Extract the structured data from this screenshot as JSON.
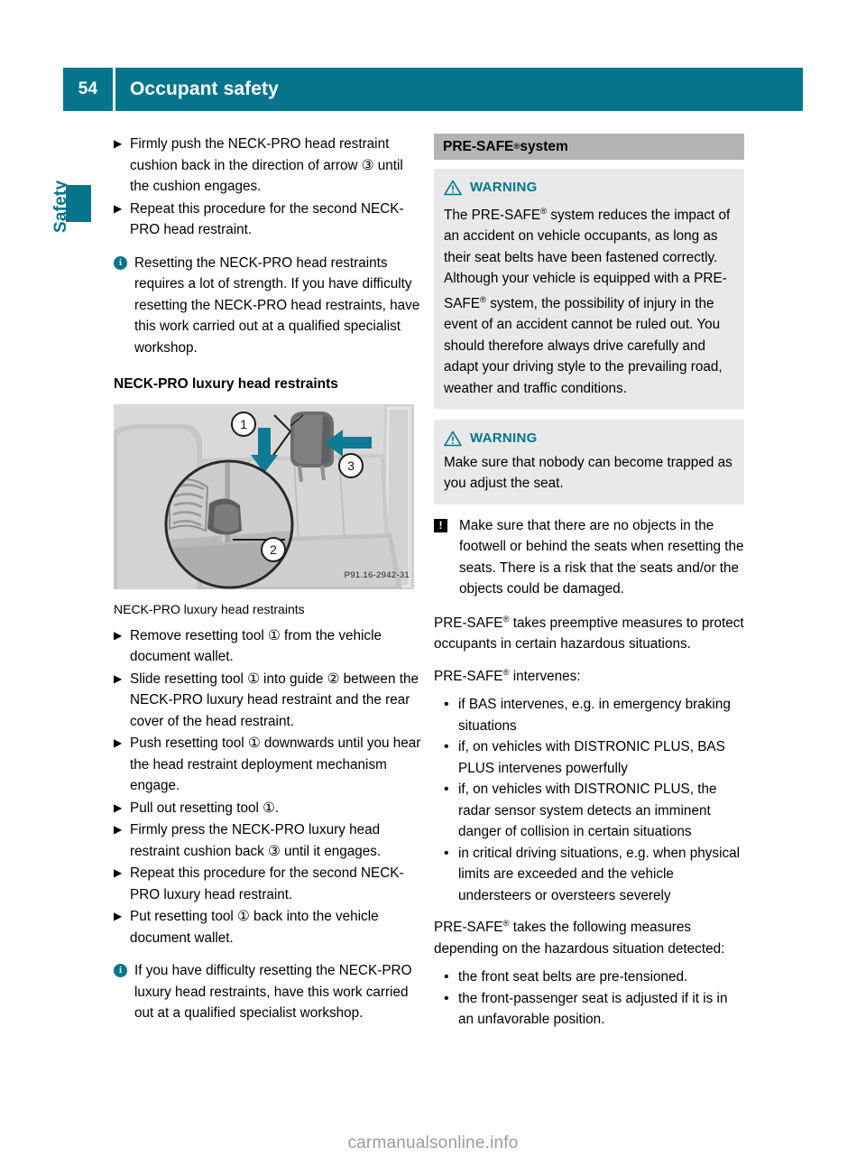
{
  "header": {
    "page_number": "54",
    "title": "Occupant safety",
    "bar_color": "#05758c"
  },
  "chapter_tab": {
    "label": "Safety",
    "color": "#05758c"
  },
  "left_column": {
    "steps_top": [
      "Firmly push the NECK-PRO head restraint cushion back in the direction of arrow ③ until the cushion engages.",
      "Repeat this procedure for the second NECK-PRO head restraint."
    ],
    "note_top": {
      "icon": "info-icon",
      "text": "Resetting the NECK-PRO head restraints requires a lot of strength. If you have difficulty resetting the NECK-PRO head restraints, have this work carried out at a qualified specialist workshop."
    },
    "subheading": "NECK-PRO luxury head restraints",
    "figure": {
      "caption": "NECK-PRO luxury head restraints",
      "code": "P91.16-2942-31",
      "callouts": [
        "1",
        "2",
        "3"
      ]
    },
    "steps_bottom": [
      "Remove resetting tool ① from the vehicle document wallet.",
      "Slide resetting tool ① into guide ② between the NECK-PRO luxury head restraint and the rear cover of the head restraint.",
      "Push resetting tool ① downwards until you hear the head restraint deployment mechanism engage.",
      "Pull out resetting tool ①.",
      "Firmly press the NECK-PRO luxury head restraint cushion back ③ until it engages.",
      "Repeat this procedure for the second NECK-PRO luxury head restraint.",
      "Put resetting tool ① back into the vehicle document wallet."
    ],
    "note_bottom": {
      "icon": "info-icon",
      "text": "If you have difficulty resetting the NECK-PRO luxury head restraints, have this work carried out at a qualified specialist workshop."
    }
  },
  "right_column": {
    "section_title_prefix": "PRE-SAFE",
    "section_title_sup": "®",
    "section_title_suffix": " system",
    "warnings": [
      {
        "icon": "warning-triangle-icon",
        "label": "WARNING",
        "body_parts": [
          "The PRE-SAFE",
          "®",
          " system reduces the impact of an accident on vehicle occupants, as long as their seat belts have been fastened correctly. Although your vehicle is equipped with a PRE-SAFE",
          "®",
          " system, the possibility of injury in the event of an accident cannot be ruled out. You should therefore always drive carefully and adapt your driving style to the prevailing road, weather and traffic conditions."
        ]
      },
      {
        "icon": "warning-triangle-icon",
        "label": "WARNING",
        "body_parts": [
          "Make sure that nobody can become trapped as you adjust the seat.",
          "",
          "",
          "",
          ""
        ]
      }
    ],
    "caution": {
      "icon": "caution-box-icon",
      "text": "Make sure that there are no objects in the footwell or behind the seats when resetting the seats. There is a risk that the seats and/or the objects could be damaged."
    },
    "para_1_pre": "PRE-SAFE",
    "para_1_sup": "®",
    "para_1_post": " takes preemptive measures to protect occupants in certain hazardous situations.",
    "para_2_pre": "PRE-SAFE",
    "para_2_sup": "®",
    "para_2_post": " intervenes:",
    "intervenes_list": [
      "if BAS intervenes, e.g. in emergency braking situations",
      "if, on vehicles with DISTRONIC PLUS, BAS PLUS intervenes powerfully",
      "if, on vehicles with DISTRONIC PLUS, the radar sensor system detects an imminent danger of collision in certain situations",
      "in critical driving situations, e.g. when physical limits are exceeded and the vehicle understeers or oversteers severely"
    ],
    "para_3_pre": "PRE-SAFE",
    "para_3_sup": "®",
    "para_3_post": " takes the following measures depending on the hazardous situation detected:",
    "measures_list": [
      "the front seat belts are pre-tensioned.",
      "the front-passenger seat is adjusted if it is in an unfavorable position."
    ]
  },
  "footer": {
    "watermark": "carmanualsonline.info"
  }
}
